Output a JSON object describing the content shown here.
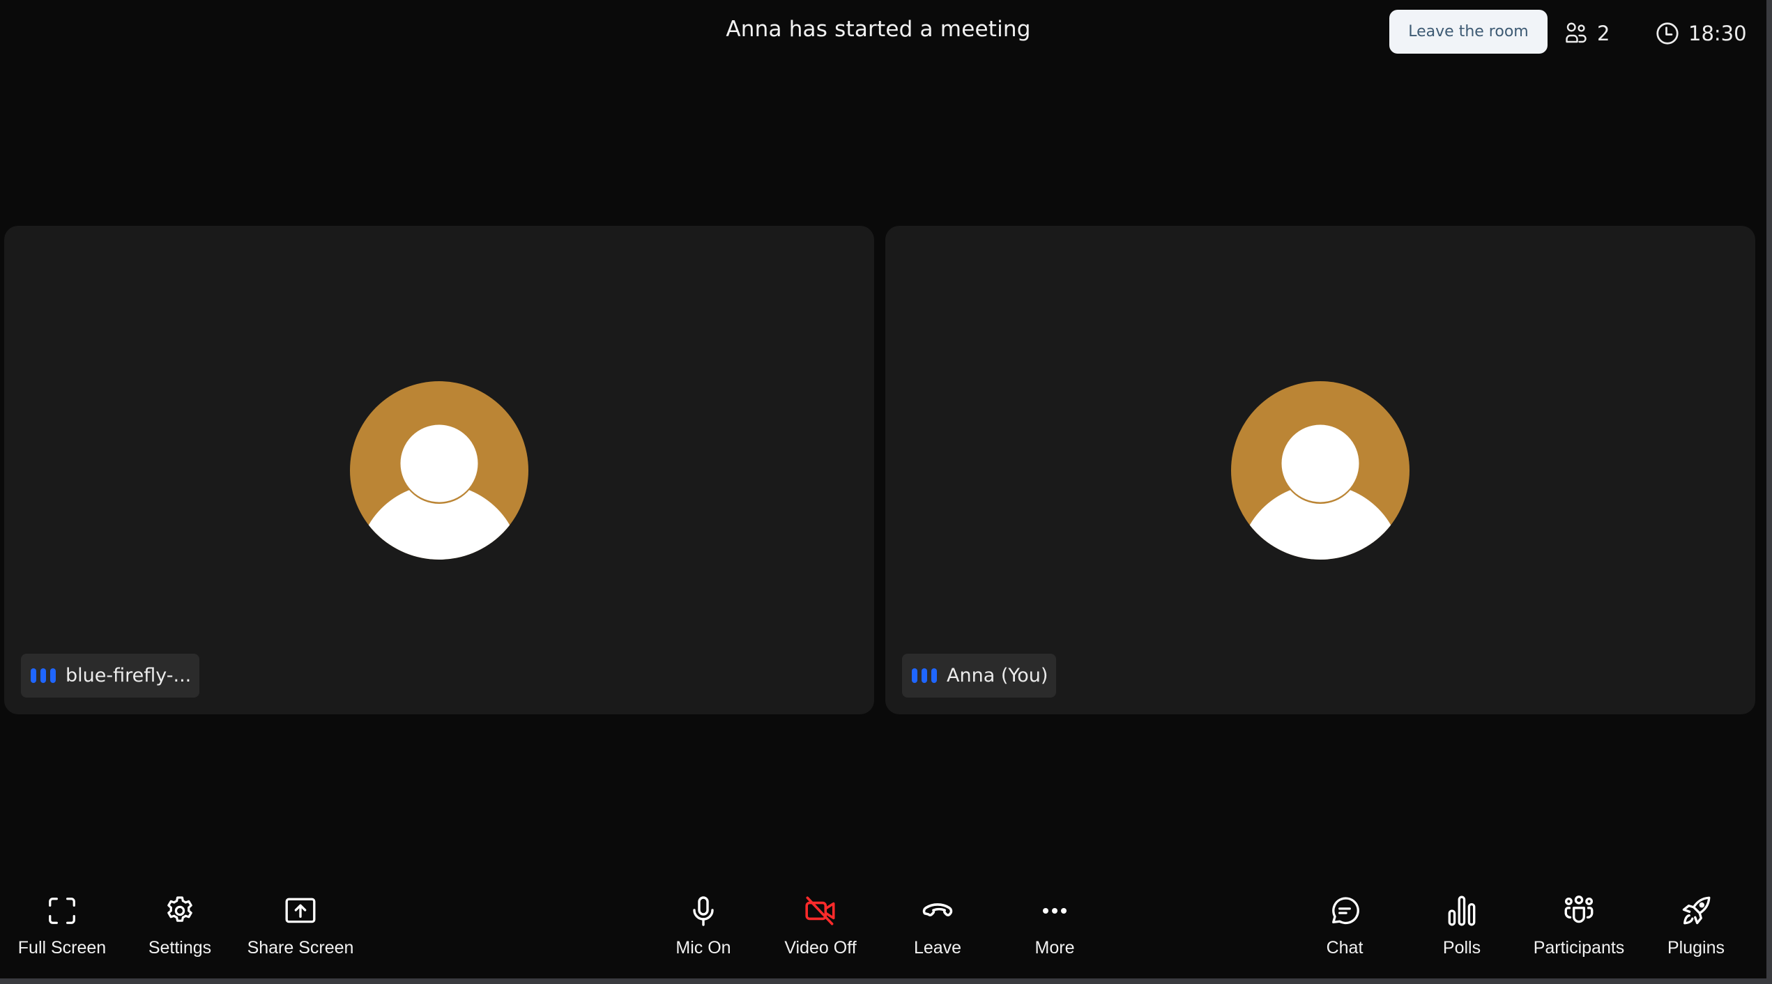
{
  "header": {
    "title": "Anna has started a meeting",
    "leave_room_label": "Leave the room",
    "participant_count": "2",
    "participants_icon": "users-icon",
    "clock_icon": "clock-icon",
    "time": "18:30"
  },
  "tiles": [
    {
      "name": "blue-firefly-...",
      "audio_indicator": "audio-bars-icon",
      "avatar_icon": "user-avatar-icon",
      "avatar_color": "#bb8535",
      "video": "off"
    },
    {
      "name": "Anna (You)",
      "audio_indicator": "audio-bars-icon",
      "avatar_icon": "user-avatar-icon",
      "avatar_color": "#bb8535",
      "video": "off"
    }
  ],
  "toolbar": {
    "left": [
      {
        "label": "Full Screen",
        "icon": "fullscreen-icon"
      },
      {
        "label": "Settings",
        "icon": "gear-icon"
      },
      {
        "label": "Share Screen",
        "icon": "share-screen-icon"
      }
    ],
    "center": [
      {
        "label": "Mic On",
        "icon": "microphone-icon"
      },
      {
        "label": "Video Off",
        "icon": "video-off-icon",
        "color": "#ff2b2b"
      },
      {
        "label": "Leave",
        "icon": "phone-hangup-icon"
      },
      {
        "label": "More",
        "icon": "more-dots-icon"
      }
    ],
    "right": [
      {
        "label": "Chat",
        "icon": "chat-icon"
      },
      {
        "label": "Polls",
        "icon": "polls-icon"
      },
      {
        "label": "Participants",
        "icon": "participants-icon"
      },
      {
        "label": "Plugins",
        "icon": "rocket-icon"
      }
    ]
  },
  "colors": {
    "background": "#0a0a0a",
    "tile": "#1a1a1a",
    "name_tag": "#2b2b2b",
    "audio_indicator": "#1f66ff",
    "danger": "#ff2b2b",
    "leave_button_bg": "#f1f4f8",
    "leave_button_text": "#3d5a73"
  }
}
